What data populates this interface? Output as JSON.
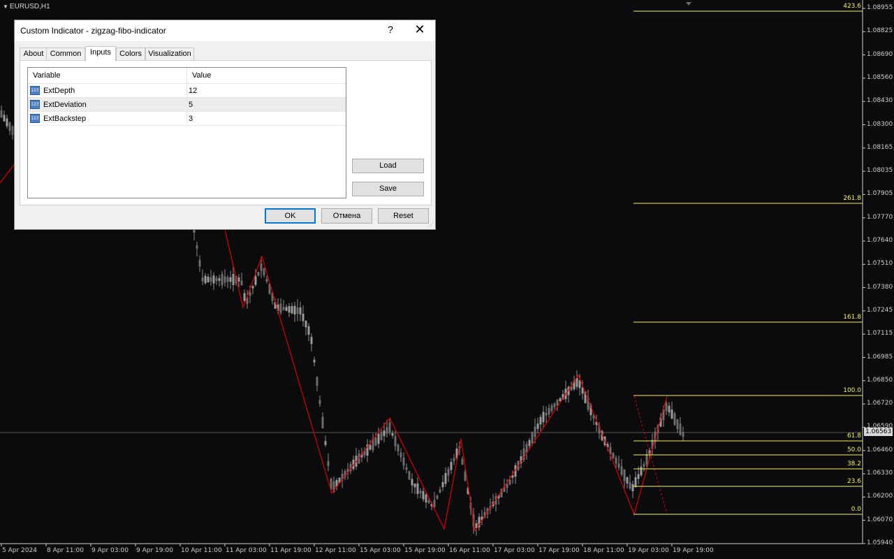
{
  "chart": {
    "symbol_title": "EURUSD,H1",
    "price_axis": [
      "1.08955",
      "1.08825",
      "1.08690",
      "1.08560",
      "1.08430",
      "1.08300",
      "1.08165",
      "1.08035",
      "1.07905",
      "1.07770",
      "1.07640",
      "1.07510",
      "1.07380",
      "1.07245",
      "1.07115",
      "1.06985",
      "1.06850",
      "1.06720",
      "1.06590",
      "1.06460",
      "1.06330",
      "1.06200",
      "1.06070",
      "1.05940"
    ],
    "current_price": "1.06563",
    "date_axis": [
      "5 Apr 2024",
      "8 Apr 11:00",
      "9 Apr 03:00",
      "9 Apr 19:00",
      "10 Apr 11:00",
      "11 Apr 03:00",
      "11 Apr 19:00",
      "12 Apr 11:00",
      "15 Apr 03:00",
      "15 Apr 19:00",
      "16 Apr 11:00",
      "17 Apr 03:00",
      "17 Apr 19:00",
      "18 Apr 11:00",
      "19 Apr 03:00",
      "19 Apr 19:00"
    ],
    "fib_levels": [
      "423.6",
      "261.8",
      "161.8",
      "100.0",
      "61.8",
      "50.0",
      "38.2",
      "23.6",
      "0.0"
    ],
    "colors": {
      "background": "#0b0b0d",
      "candle": "#8c8c8c",
      "zigzag": "#e00000",
      "fib": "#f2f25a",
      "axis_text": "#cfcfcf"
    }
  },
  "dialog": {
    "title": "Custom Indicator - zigzag-fibo-indicator",
    "help_label": "?",
    "close_icon": "close-icon",
    "tabs": [
      "About",
      "Common",
      "Inputs",
      "Colors",
      "Visualization"
    ],
    "active_tab": "Inputs",
    "table": {
      "headers": [
        "Variable",
        "Value"
      ],
      "rows": [
        {
          "variable": "ExtDepth",
          "value": "12",
          "icon": "param-123-icon",
          "icon_text": "123"
        },
        {
          "variable": "ExtDeviation",
          "value": "5",
          "icon": "param-123-icon",
          "icon_text": "123"
        },
        {
          "variable": "ExtBackstep",
          "value": "3",
          "icon": "param-123-icon",
          "icon_text": "123"
        }
      ]
    },
    "buttons": {
      "load": "Load",
      "save": "Save",
      "ok": "OK",
      "cancel": "Отмена",
      "reset": "Reset"
    }
  }
}
